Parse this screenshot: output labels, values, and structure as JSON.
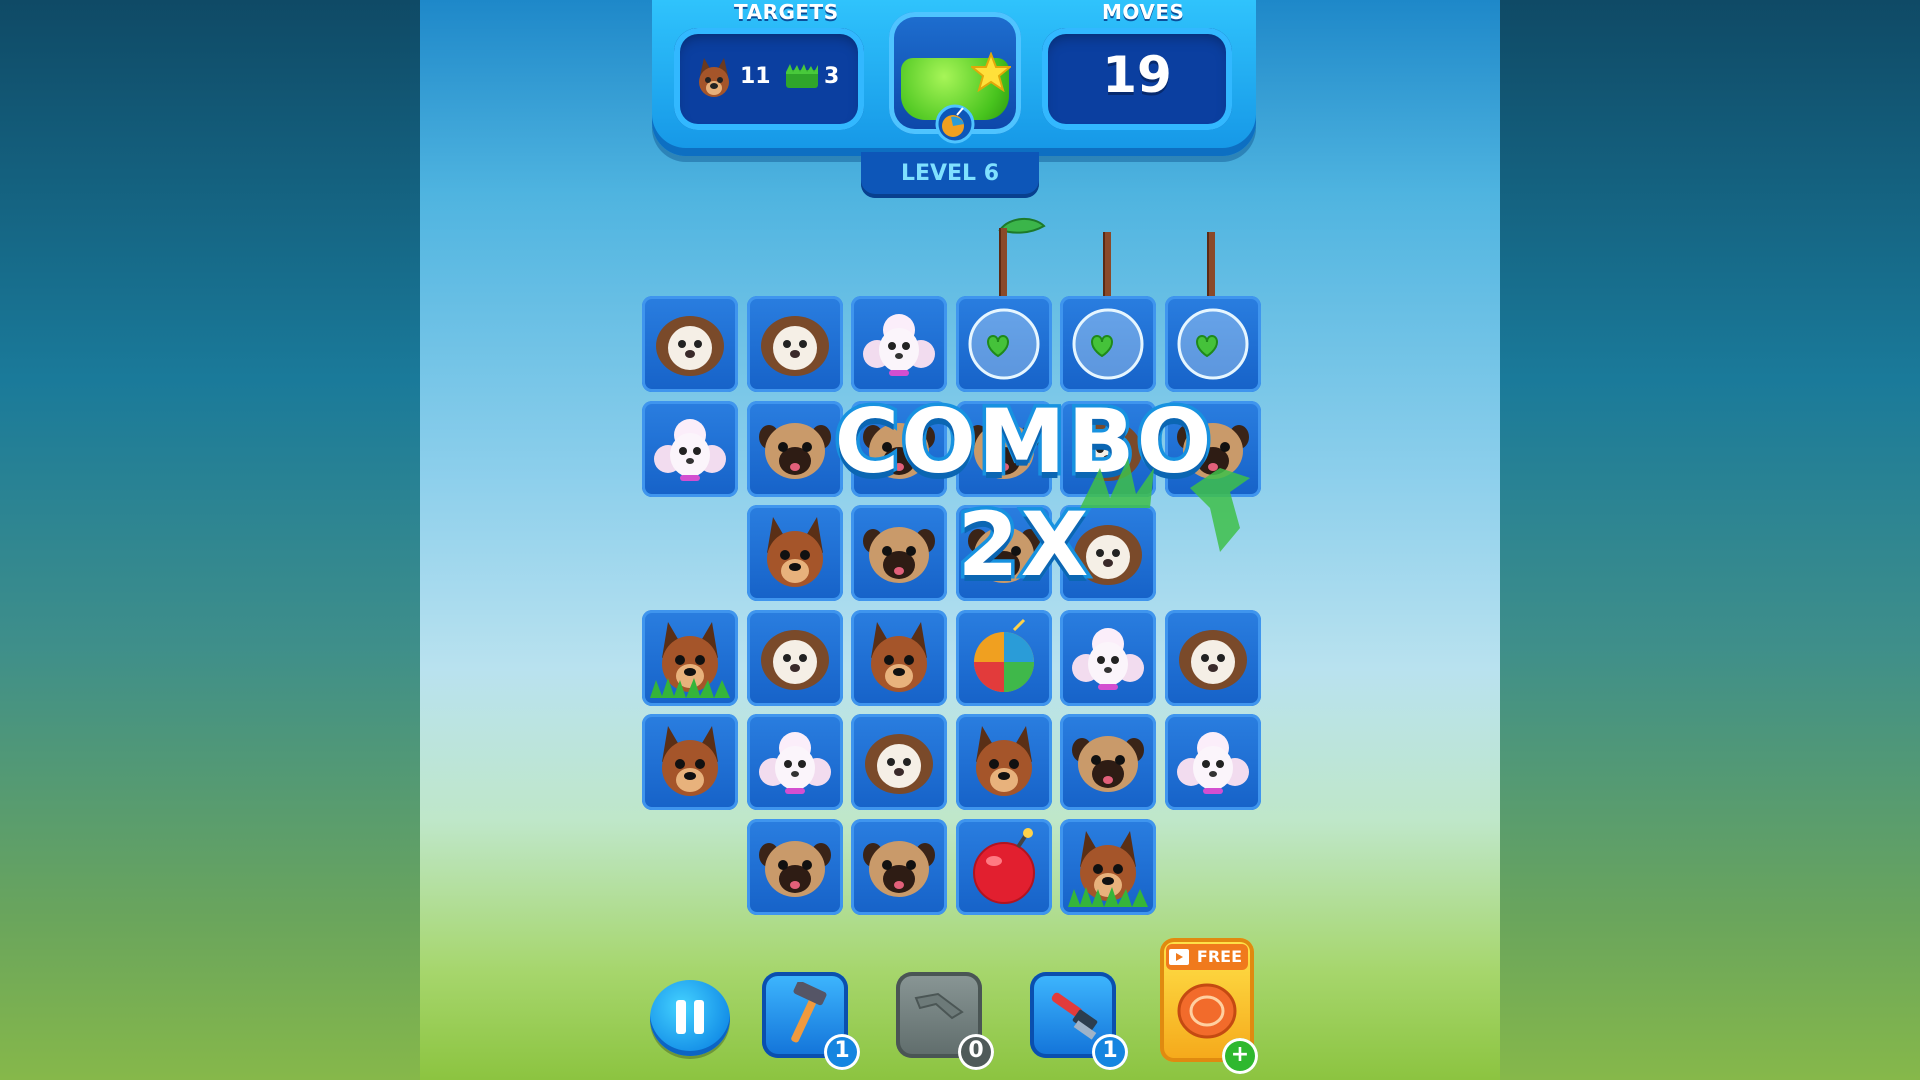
{
  "hud": {
    "targets_label": "TARGETS",
    "moves_label": "MOVES",
    "moves_value": "19",
    "targets": [
      {
        "icon": "shepherd-dog-icon",
        "count": "11"
      },
      {
        "icon": "grass-icon",
        "count": "3"
      }
    ],
    "level_label": "LEVEL 6"
  },
  "combo_text": "COMBO 2X",
  "board": {
    "rows": [
      [
        "shihtzu",
        "shihtzu",
        "poodle",
        "bubble",
        "bubble",
        "bubble"
      ],
      [
        "poodle",
        "pug",
        "pug",
        "pug",
        "shihtzu",
        "pug"
      ],
      [
        "empty",
        "shepherd",
        "pug",
        "pug",
        "shihtzu",
        "empty"
      ],
      [
        "shepherd-grass",
        "shihtzu",
        "shepherd",
        "beachball",
        "poodle",
        "shihtzu"
      ],
      [
        "shepherd",
        "poodle",
        "shihtzu",
        "shepherd",
        "pug",
        "poodle"
      ],
      [
        "empty",
        "pug",
        "pug",
        "bomb",
        "shepherd-grass",
        "empty"
      ]
    ]
  },
  "boosters": [
    {
      "name": "hammer",
      "count": "1"
    },
    {
      "name": "boomerang",
      "count": "0"
    },
    {
      "name": "brush",
      "count": "1"
    },
    {
      "name": "frisbee",
      "label": "FREE",
      "action": "+"
    }
  ],
  "colors": {
    "accent": "#1596e6",
    "panel": "#0b3fa0",
    "tile": "#1662c8"
  }
}
